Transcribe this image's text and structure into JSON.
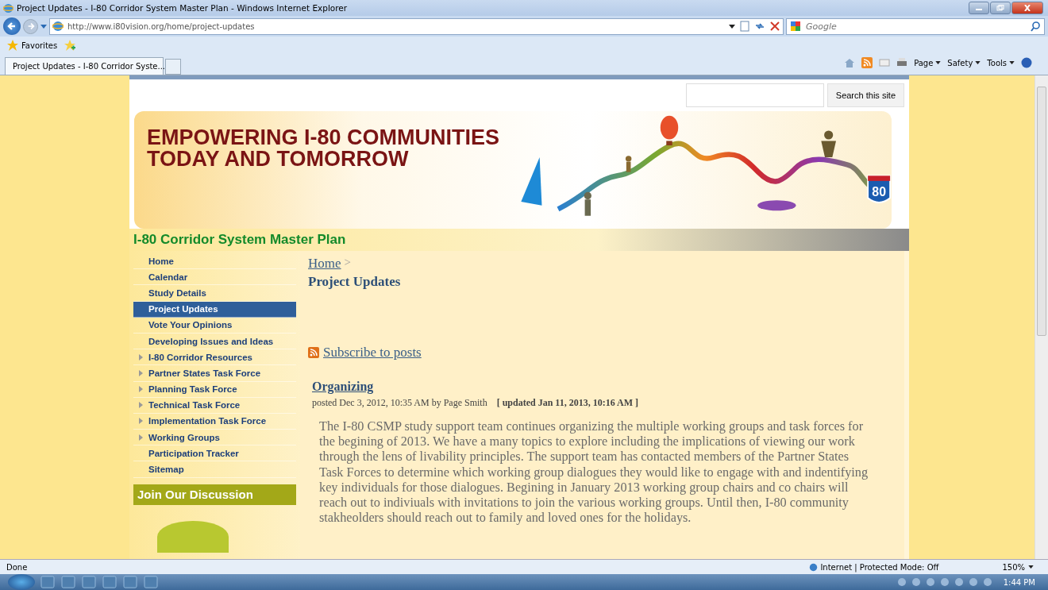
{
  "window": {
    "title": "Project Updates - I-80 Corridor System Master Plan - Windows Internet Explorer"
  },
  "address_bar": {
    "url": "http://www.i80vision.org/home/project-updates"
  },
  "search_box": {
    "placeholder": "Google"
  },
  "favorites_bar": {
    "label": "Favorites"
  },
  "tabs": [
    {
      "label": "Project Updates - I-80 Corridor Syste...",
      "selected": true
    }
  ],
  "command_bar": [
    "Page",
    "Safety",
    "Tools"
  ],
  "site": {
    "search_button": "Search this site",
    "banner": {
      "headline": [
        "EMPOWERING I-80 COMMUNITIES",
        "TODAY AND TOMORROW"
      ],
      "shield_label": "80"
    },
    "title": "I-80 Corridor System Master Plan",
    "sidebar": {
      "items": [
        {
          "label": "Home",
          "selected": false,
          "expandable": false
        },
        {
          "label": "Calendar",
          "selected": false,
          "expandable": false
        },
        {
          "label": "Study Details",
          "selected": false,
          "expandable": false
        },
        {
          "label": "Project Updates",
          "selected": true,
          "expandable": false
        },
        {
          "label": "Vote Your Opinions",
          "selected": false,
          "expandable": false
        },
        {
          "label": "Developing Issues and Ideas",
          "selected": false,
          "expandable": false
        },
        {
          "label": "I-80 Corridor Resources",
          "selected": false,
          "expandable": true
        },
        {
          "label": "Partner States Task Force",
          "selected": false,
          "expandable": true
        },
        {
          "label": "Planning Task Force",
          "selected": false,
          "expandable": true
        },
        {
          "label": "Technical Task Force",
          "selected": false,
          "expandable": true
        },
        {
          "label": "Implementation Task Force",
          "selected": false,
          "expandable": true
        },
        {
          "label": "Working Groups",
          "selected": false,
          "expandable": true
        },
        {
          "label": "Participation Tracker",
          "selected": false,
          "expandable": false
        },
        {
          "label": "Sitemap",
          "selected": false,
          "expandable": false
        }
      ],
      "discussion_heading": "Join Our Discussion"
    },
    "breadcrumb": {
      "link": "Home",
      "separator": ">"
    },
    "page_title": "Project Updates",
    "subscribe_link": "Subscribe to posts",
    "post": {
      "title": "Organizing",
      "meta": "posted Dec 3, 2012, 10:35 AM by Page Smith",
      "updated": "[ updated Jan 11, 2013, 10:16 AM ]",
      "body": "The I-80 CSMP study support team continues organizing the multiple working groups and task forces for the begining of 2013. We have a many topics to explore including the implications of viewing our work through the lens of livability principles. The support team has contacted members of the Partner States Task Forces to determine which working group dialogues they would like to engage with and indentifying key individuals for those dialogues. Begining in January 2013 working group chairs and co chairs will reach out to indiviuals with invitations to join the various working groups. Until then, I-80 community stakheolders should reach out to family and loved ones for the holidays."
    }
  },
  "status_bar": {
    "text": "Done",
    "zone": "Internet | Protected Mode: Off",
    "zoom": "150%"
  },
  "taskbar": {
    "clock": "1:44 PM"
  }
}
